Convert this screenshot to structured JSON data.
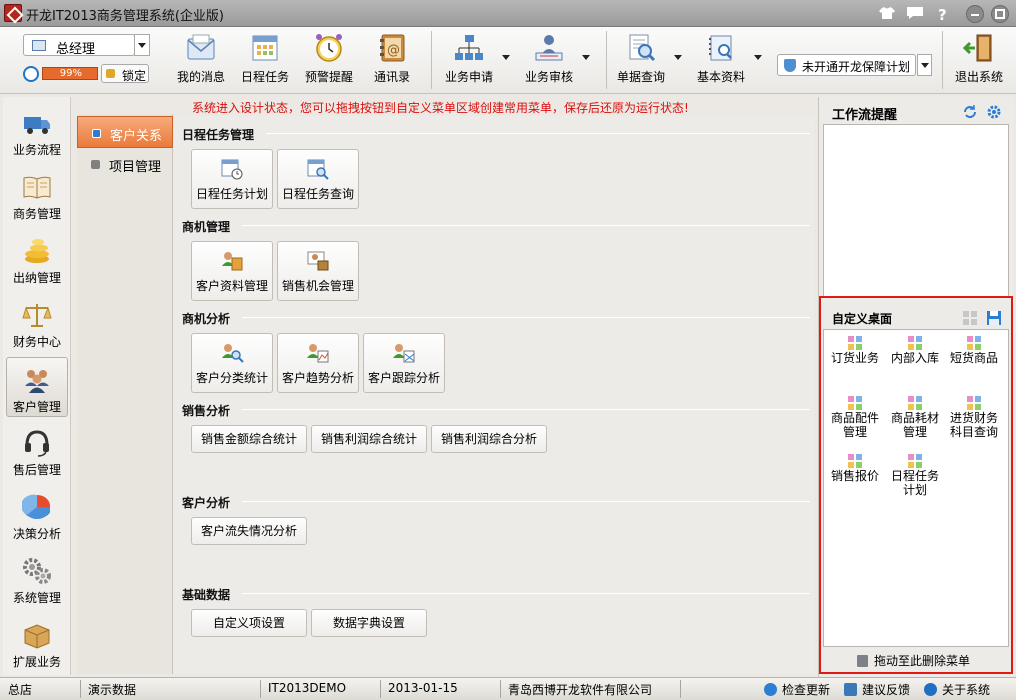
{
  "window": {
    "title": "开龙IT2013商务管理系统(企业版)"
  },
  "toolbar": {
    "user": "总经理",
    "progress_text": "99%",
    "progress_percent": 99,
    "lock_label": "锁定",
    "tools": [
      {
        "label": "我的消息",
        "icon": "message-icon"
      },
      {
        "label": "日程任务",
        "icon": "calendar-icon"
      },
      {
        "label": "预警提醒",
        "icon": "alarm-clock-icon"
      },
      {
        "label": "通讯录",
        "icon": "address-book-icon"
      },
      {
        "label": "业务申请",
        "icon": "org-chart-icon"
      },
      {
        "label": "业务审核",
        "icon": "approve-icon"
      },
      {
        "label": "单据查询",
        "icon": "document-search-icon"
      },
      {
        "label": "基本资料",
        "icon": "notebook-icon"
      }
    ],
    "plan_label": "未开通开龙保障计划",
    "exit_label": "退出系统"
  },
  "sidebar": {
    "items": [
      {
        "label": "业务流程",
        "icon": "truck-icon"
      },
      {
        "label": "商务管理",
        "icon": "book-icon"
      },
      {
        "label": "出纳管理",
        "icon": "coins-icon"
      },
      {
        "label": "财务中心",
        "icon": "scales-icon"
      },
      {
        "label": "客户管理",
        "icon": "customers-icon"
      },
      {
        "label": "售后管理",
        "icon": "headset-icon"
      },
      {
        "label": "决策分析",
        "icon": "pie-chart-icon"
      },
      {
        "label": "系统管理",
        "icon": "gears-icon"
      },
      {
        "label": "扩展业务",
        "icon": "box-icon"
      }
    ]
  },
  "categories": [
    {
      "label": "客户关系"
    },
    {
      "label": "项目管理"
    }
  ],
  "notice": "系统进入设计状态，您可以拖拽按钮到自定义菜单区域创建常用菜单，保存后还原为运行状态!",
  "sections": {
    "schedule": {
      "title": "日程任务管理",
      "tiles": [
        "日程任务计划",
        "日程任务查询"
      ]
    },
    "opportunity": {
      "title": "商机管理",
      "tiles": [
        "客户资料管理",
        "销售机会管理"
      ]
    },
    "opp_analysis": {
      "title": "商机分析",
      "tiles": [
        "客户分类统计",
        "客户趋势分析",
        "客户跟踪分析"
      ]
    },
    "sales_analysis": {
      "title": "销售分析",
      "buttons": [
        "销售金额综合统计",
        "销售利润综合统计",
        "销售利润综合分析"
      ]
    },
    "customer_analysis": {
      "title": "客户分析",
      "buttons": [
        "客户流失情况分析"
      ]
    },
    "basic_data": {
      "title": "基础数据",
      "buttons": [
        "自定义项设置",
        "数据字典设置"
      ]
    }
  },
  "right": {
    "workflow_title": "工作流提醒",
    "custom_title": "自定义桌面",
    "custom_items": [
      {
        "line1": "订货业务",
        "line2": ""
      },
      {
        "line1": "内部入库",
        "line2": ""
      },
      {
        "line1": "短货商品",
        "line2": ""
      },
      {
        "line1": "商品配件",
        "line2": "管理"
      },
      {
        "line1": "商品耗材",
        "line2": "管理"
      },
      {
        "line1": "进货财务",
        "line2": "科目查询"
      },
      {
        "line1": "销售报价",
        "line2": ""
      },
      {
        "line1": "日程任务",
        "line2": "计划"
      }
    ],
    "drop_label": "拖动至此删除菜单"
  },
  "statusbar": {
    "store": "总店",
    "data": "演示数据",
    "db": "IT2013DEMO",
    "date": "2013-01-15",
    "company": "青岛西博开龙软件有限公司",
    "check_update": "检查更新",
    "feedback": "建议反馈",
    "about": "关于系统"
  }
}
